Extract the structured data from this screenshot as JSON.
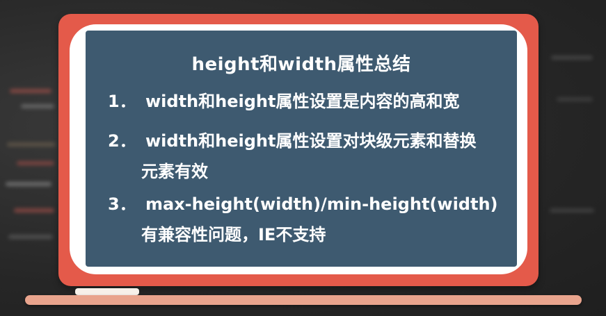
{
  "slide": {
    "title": "height和width属性总结",
    "items": [
      {
        "number": "1．",
        "lines": [
          "width和height属性设置是内容的高和宽"
        ]
      },
      {
        "number": "2．",
        "lines": [
          "width和height属性设置对块级元素和替换",
          "元素有效"
        ]
      },
      {
        "number": "3．",
        "lines": [
          "max-height(width)/min-height(width)",
          "有兼容性问题，IE不支持"
        ]
      }
    ]
  },
  "colors": {
    "frame": "#e45a4a",
    "panel": "#3e5a70",
    "text": "#ffffff",
    "tray": "#e9a48d"
  }
}
